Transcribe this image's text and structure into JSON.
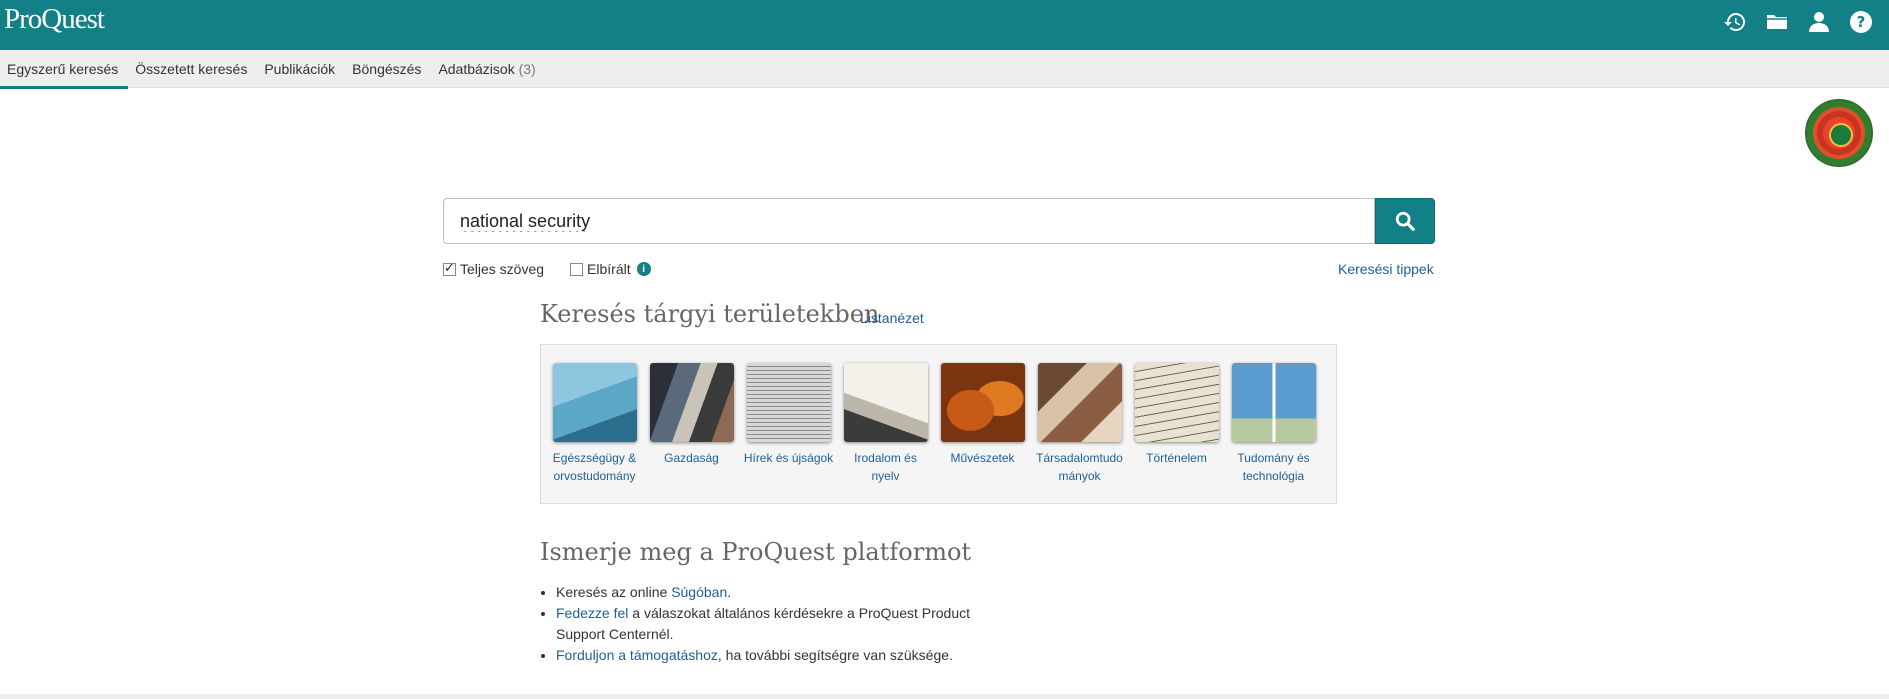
{
  "header": {
    "logo": "ProQuest",
    "icons": [
      "history-icon",
      "folder-icon",
      "user-icon",
      "help-icon"
    ],
    "accent_color": "#137f86"
  },
  "nav": {
    "tabs": [
      {
        "label": "Egyszerű keresés",
        "active": true
      },
      {
        "label": "Összetett keresés"
      },
      {
        "label": "Publikációk"
      },
      {
        "label": "Böngészés"
      },
      {
        "label": "Adatbázisok",
        "count": "(3)"
      }
    ]
  },
  "search": {
    "value": "national security",
    "button_icon": "search-icon",
    "options": {
      "full_text": {
        "label": "Teljes szöveg",
        "checked": true
      },
      "peer_reviewed": {
        "label": "Elbírált",
        "checked": false
      }
    },
    "tips_link": "Keresési tippek"
  },
  "subjects": {
    "title": "Keresés tárgyi területekben",
    "list_link": "Listanézet",
    "items": [
      {
        "line1": "Egészségügy &",
        "line2": "orvostudomány"
      },
      {
        "line1": "Gazdaság",
        "line2": ""
      },
      {
        "line1": "Hírek és újságok",
        "line2": ""
      },
      {
        "line1": "Irodalom és",
        "line2": "nyelv"
      },
      {
        "line1": "Művészetek",
        "line2": ""
      },
      {
        "line1": "Társadalomtudo",
        "line2": "mányok"
      },
      {
        "line1": "Történelem",
        "line2": ""
      },
      {
        "line1": "Tudomány és",
        "line2": "technológia"
      }
    ]
  },
  "platform": {
    "title": "Ismerje meg a ProQuest platformot",
    "bullets": [
      {
        "pre": "Keresés az online ",
        "link": "Súgóban",
        "post": "."
      },
      {
        "pre": "",
        "link": "Fedezze fel",
        "post": " a válaszokat általános kérdésekre a ProQuest Product Support Centernél."
      },
      {
        "pre": "",
        "link": "Forduljon a támogatáshoz",
        "post": ", ha további segítségre van szüksége."
      }
    ]
  }
}
